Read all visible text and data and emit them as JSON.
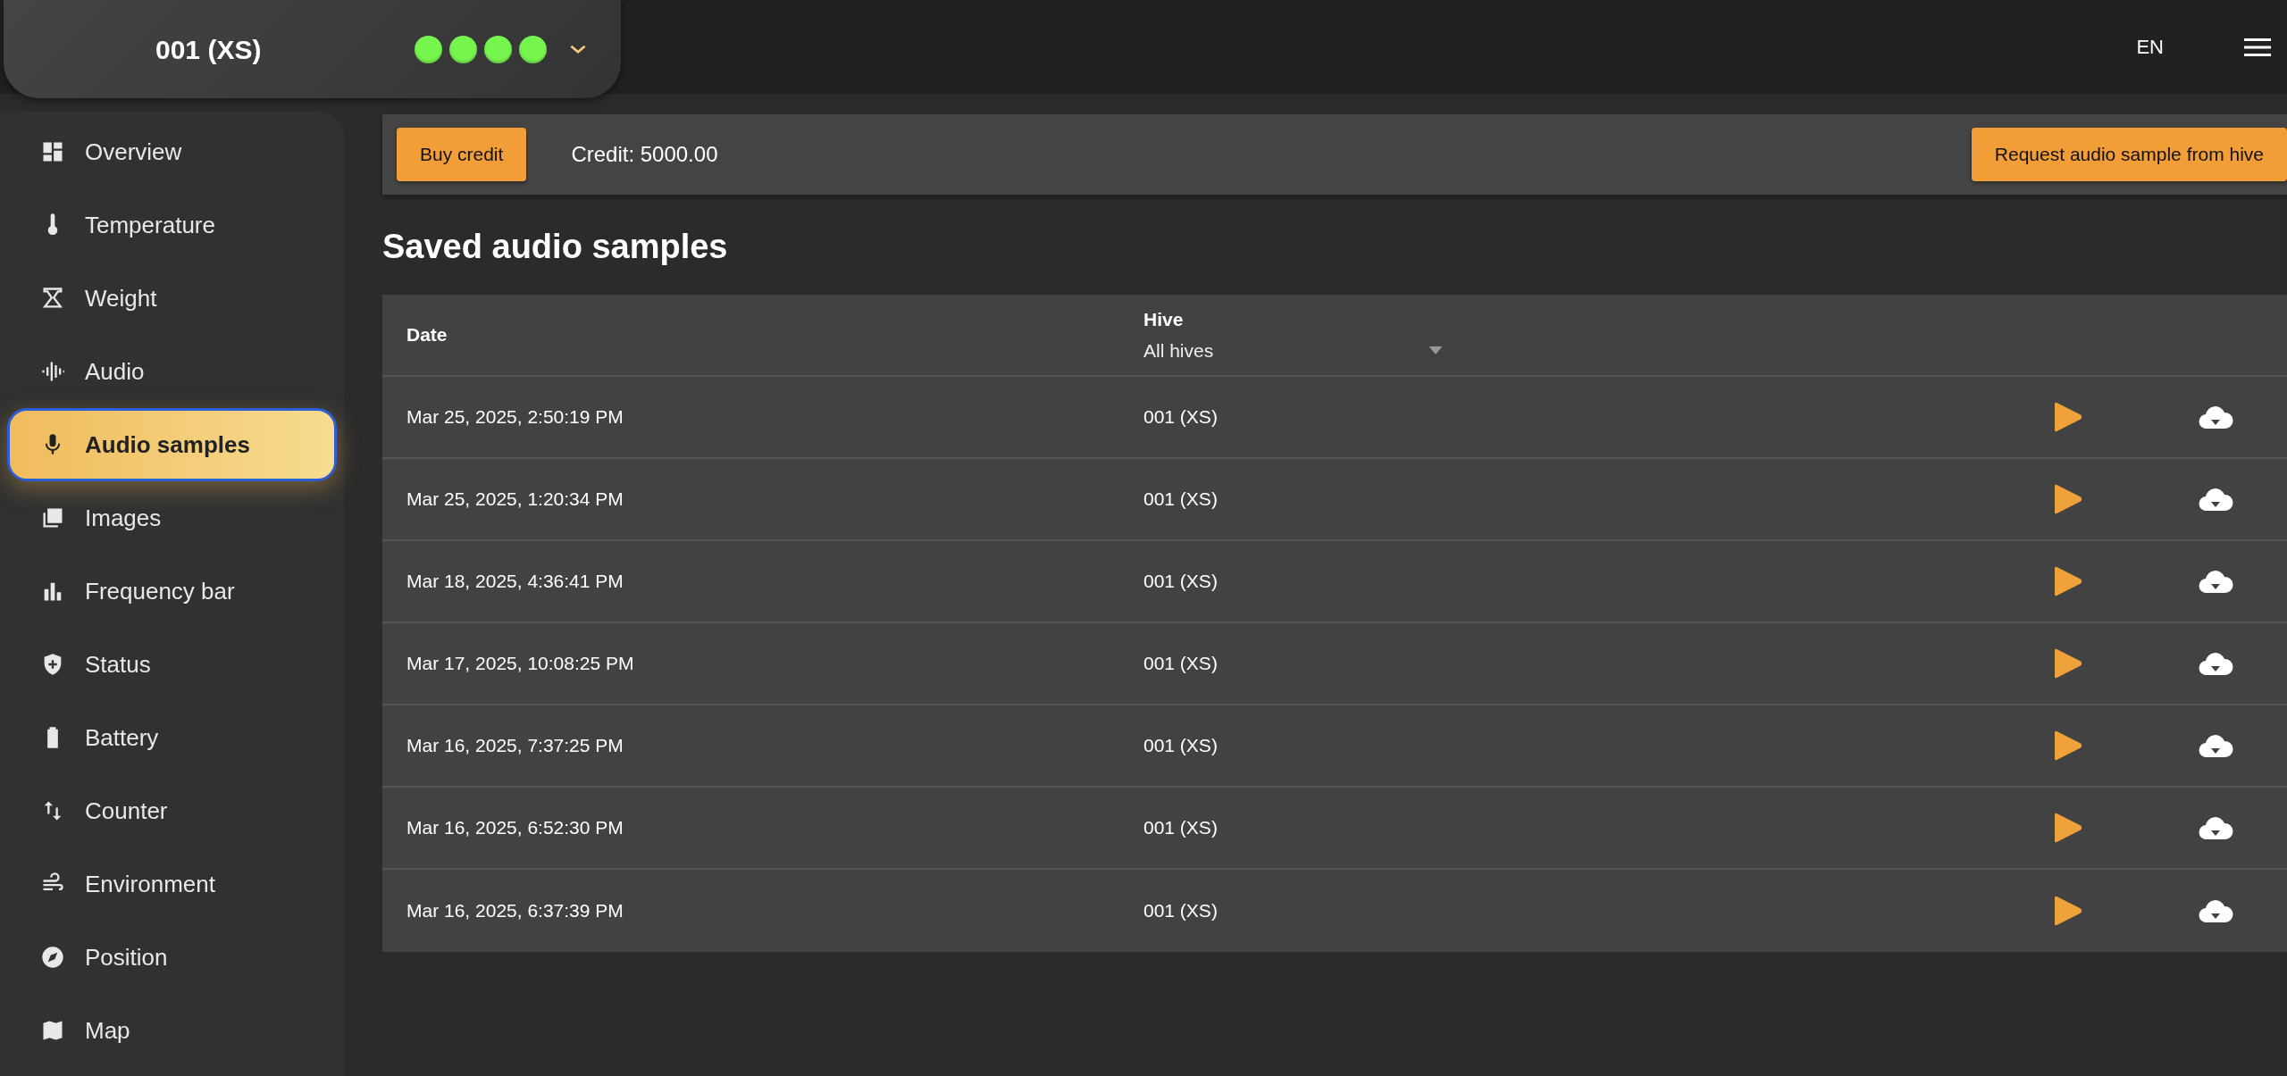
{
  "hive_selector": {
    "title": "001 (XS)",
    "status_dots": [
      {
        "color": "#77f54f"
      },
      {
        "color": "#77f54f"
      },
      {
        "color": "#77f54f"
      },
      {
        "color": "#77f54f"
      }
    ]
  },
  "topbar": {
    "language": "EN"
  },
  "sidebar": {
    "items": [
      {
        "label": "Overview",
        "selected": false
      },
      {
        "label": "Temperature",
        "selected": false
      },
      {
        "label": "Weight",
        "selected": false
      },
      {
        "label": "Audio",
        "selected": false
      },
      {
        "label": "Audio samples",
        "selected": true
      },
      {
        "label": "Images",
        "selected": false
      },
      {
        "label": "Frequency bar",
        "selected": false
      },
      {
        "label": "Status",
        "selected": false
      },
      {
        "label": "Battery",
        "selected": false
      },
      {
        "label": "Counter",
        "selected": false
      },
      {
        "label": "Environment",
        "selected": false
      },
      {
        "label": "Position",
        "selected": false
      },
      {
        "label": "Map",
        "selected": false
      }
    ]
  },
  "toolbar": {
    "buy_button": "Buy credit",
    "credit": "Credit: 5000.00",
    "request_button": "Request audio sample from hive"
  },
  "heading": "Saved audio samples",
  "table": {
    "columns": [
      "Date",
      "Hive"
    ],
    "hive_filter": {
      "value": "All hives"
    },
    "rows": [
      {
        "date": "Mar 25, 2025, 2:50:19 PM",
        "hive": "001 (XS)"
      },
      {
        "date": "Mar 25, 2025, 1:20:34 PM",
        "hive": "001 (XS)"
      },
      {
        "date": "Mar 18, 2025, 4:36:41 PM",
        "hive": "001 (XS)"
      },
      {
        "date": "Mar 17, 2025, 10:08:25 PM",
        "hive": "001 (XS)"
      },
      {
        "date": "Mar 16, 2025, 7:37:25 PM",
        "hive": "001 (XS)"
      },
      {
        "date": "Mar 16, 2025, 6:52:30 PM",
        "hive": "001 (XS)"
      },
      {
        "date": "Mar 16, 2025, 6:37:39 PM",
        "hive": "001 (XS)"
      }
    ]
  }
}
